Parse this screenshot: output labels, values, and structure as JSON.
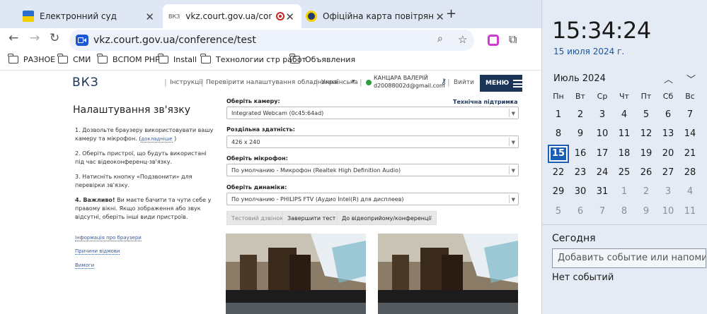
{
  "browser": {
    "tabs": [
      {
        "title": "Електронний суд"
      },
      {
        "title": "ВКЗ",
        "url_title": "vkz.court.gov.ua/conference/t"
      },
      {
        "title": "Офіційна карта повітряних триво"
      }
    ],
    "new_tab_label": "+",
    "address": "vkz.court.gov.ua/conference/test",
    "bookmarks": [
      "РАЗНОЕ",
      "СМИ",
      "ВСПОМ РНР",
      "Install",
      "Технологии стр работ",
      "Объявления"
    ]
  },
  "site": {
    "logo": "ВКЗ",
    "links": {
      "instructions": "Інструкції",
      "check_settings": "Перевірити налаштування обладнання",
      "language": "Українська",
      "logout": "Вийти"
    },
    "user_name": "КАНЦАРА ВАЛЕРІЙ",
    "user_email": "d20088002d@gmail.com",
    "menu_label": "МЕНЮ",
    "page_title": "Налаштування зв'язку",
    "steps": {
      "s1": "1. Дозвольте браузеру використовувати вашу камеру та мікрофон. (",
      "s1_link": "докладніше",
      "s1_end": ")",
      "s2": "2. Оберіть пристрої, що будуть використані під час відеоконференц-зв'язку.",
      "s3": "3. Натисніть кнопку «Подзвонити» для перевірки зв'язку.",
      "s4_bold": "4. Важливо!",
      "s4": " Ви маєте бачити та чути себе у правому вікні. Якщо зображення або звук відсутні, оберіть інші види пристроїв."
    },
    "side_links": [
      "Інформація про браузери",
      "Причини відмови",
      "Вимоги"
    ],
    "support": "Технічна підтримка",
    "camera_label": "Оберіть камеру:",
    "camera_value": "Integrated Webcam (0c45:64ad)",
    "resolution_label": "Роздільна здатність:",
    "resolution_value": "426 x 240",
    "mic_label": "Оберіть мікрофон:",
    "mic_value": "По умолчанию - Микрофон (Realtek High Definition Audio)",
    "speaker_label": "Оберіть динаміки:",
    "speaker_value": "По умолчанию - PHILIPS FTV (Аудио Intel(R) для дисплеев)",
    "buttons": {
      "test_call": "Тестовий дзвінок",
      "end_test": "Завершити тест",
      "to_conference": "До відеоприйому/конференції"
    }
  },
  "calendar": {
    "time": "15:34:24",
    "date": "15 июля 2024 г.",
    "month": "Июль 2024",
    "weekdays": [
      "Пн",
      "Вт",
      "Ср",
      "Чт",
      "Пт",
      "Сб",
      "Вс"
    ],
    "weeks": [
      [
        "1",
        "2",
        "3",
        "4",
        "5",
        "6",
        "7"
      ],
      [
        "8",
        "9",
        "10",
        "11",
        "12",
        "13",
        "14"
      ],
      [
        "15",
        "16",
        "17",
        "18",
        "19",
        "20",
        "21"
      ],
      [
        "22",
        "23",
        "24",
        "25",
        "26",
        "27",
        "28"
      ],
      [
        "29",
        "30",
        "31",
        "1",
        "2",
        "3",
        "4"
      ],
      [
        "5",
        "6",
        "7",
        "8",
        "9",
        "10",
        "11"
      ]
    ],
    "today": "15",
    "today_label": "Сегодня",
    "event_placeholder": "Добавить событие или напоминание",
    "no_events": "Нет событий",
    "colors": {
      "accent": "#1a5fb4",
      "background": "#e4ebf4"
    }
  }
}
